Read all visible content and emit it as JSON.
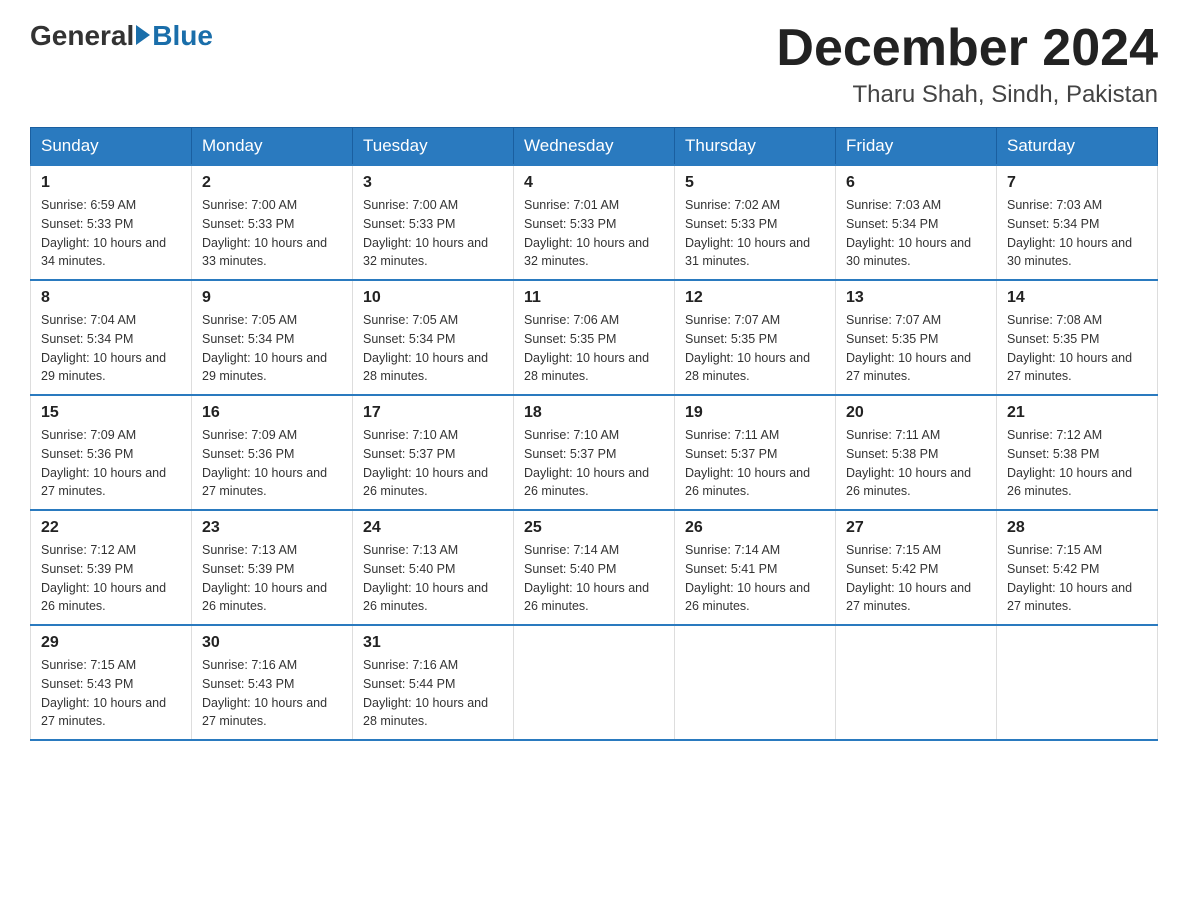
{
  "header": {
    "logo_general": "General",
    "logo_blue": "Blue",
    "month_year": "December 2024",
    "location": "Tharu Shah, Sindh, Pakistan"
  },
  "days_of_week": [
    "Sunday",
    "Monday",
    "Tuesday",
    "Wednesday",
    "Thursday",
    "Friday",
    "Saturday"
  ],
  "weeks": [
    [
      {
        "day": "1",
        "sunrise": "6:59 AM",
        "sunset": "5:33 PM",
        "daylight": "10 hours and 34 minutes."
      },
      {
        "day": "2",
        "sunrise": "7:00 AM",
        "sunset": "5:33 PM",
        "daylight": "10 hours and 33 minutes."
      },
      {
        "day": "3",
        "sunrise": "7:00 AM",
        "sunset": "5:33 PM",
        "daylight": "10 hours and 32 minutes."
      },
      {
        "day": "4",
        "sunrise": "7:01 AM",
        "sunset": "5:33 PM",
        "daylight": "10 hours and 32 minutes."
      },
      {
        "day": "5",
        "sunrise": "7:02 AM",
        "sunset": "5:33 PM",
        "daylight": "10 hours and 31 minutes."
      },
      {
        "day": "6",
        "sunrise": "7:03 AM",
        "sunset": "5:34 PM",
        "daylight": "10 hours and 30 minutes."
      },
      {
        "day": "7",
        "sunrise": "7:03 AM",
        "sunset": "5:34 PM",
        "daylight": "10 hours and 30 minutes."
      }
    ],
    [
      {
        "day": "8",
        "sunrise": "7:04 AM",
        "sunset": "5:34 PM",
        "daylight": "10 hours and 29 minutes."
      },
      {
        "day": "9",
        "sunrise": "7:05 AM",
        "sunset": "5:34 PM",
        "daylight": "10 hours and 29 minutes."
      },
      {
        "day": "10",
        "sunrise": "7:05 AM",
        "sunset": "5:34 PM",
        "daylight": "10 hours and 28 minutes."
      },
      {
        "day": "11",
        "sunrise": "7:06 AM",
        "sunset": "5:35 PM",
        "daylight": "10 hours and 28 minutes."
      },
      {
        "day": "12",
        "sunrise": "7:07 AM",
        "sunset": "5:35 PM",
        "daylight": "10 hours and 28 minutes."
      },
      {
        "day": "13",
        "sunrise": "7:07 AM",
        "sunset": "5:35 PM",
        "daylight": "10 hours and 27 minutes."
      },
      {
        "day": "14",
        "sunrise": "7:08 AM",
        "sunset": "5:35 PM",
        "daylight": "10 hours and 27 minutes."
      }
    ],
    [
      {
        "day": "15",
        "sunrise": "7:09 AM",
        "sunset": "5:36 PM",
        "daylight": "10 hours and 27 minutes."
      },
      {
        "day": "16",
        "sunrise": "7:09 AM",
        "sunset": "5:36 PM",
        "daylight": "10 hours and 27 minutes."
      },
      {
        "day": "17",
        "sunrise": "7:10 AM",
        "sunset": "5:37 PM",
        "daylight": "10 hours and 26 minutes."
      },
      {
        "day": "18",
        "sunrise": "7:10 AM",
        "sunset": "5:37 PM",
        "daylight": "10 hours and 26 minutes."
      },
      {
        "day": "19",
        "sunrise": "7:11 AM",
        "sunset": "5:37 PM",
        "daylight": "10 hours and 26 minutes."
      },
      {
        "day": "20",
        "sunrise": "7:11 AM",
        "sunset": "5:38 PM",
        "daylight": "10 hours and 26 minutes."
      },
      {
        "day": "21",
        "sunrise": "7:12 AM",
        "sunset": "5:38 PM",
        "daylight": "10 hours and 26 minutes."
      }
    ],
    [
      {
        "day": "22",
        "sunrise": "7:12 AM",
        "sunset": "5:39 PM",
        "daylight": "10 hours and 26 minutes."
      },
      {
        "day": "23",
        "sunrise": "7:13 AM",
        "sunset": "5:39 PM",
        "daylight": "10 hours and 26 minutes."
      },
      {
        "day": "24",
        "sunrise": "7:13 AM",
        "sunset": "5:40 PM",
        "daylight": "10 hours and 26 minutes."
      },
      {
        "day": "25",
        "sunrise": "7:14 AM",
        "sunset": "5:40 PM",
        "daylight": "10 hours and 26 minutes."
      },
      {
        "day": "26",
        "sunrise": "7:14 AM",
        "sunset": "5:41 PM",
        "daylight": "10 hours and 26 minutes."
      },
      {
        "day": "27",
        "sunrise": "7:15 AM",
        "sunset": "5:42 PM",
        "daylight": "10 hours and 27 minutes."
      },
      {
        "day": "28",
        "sunrise": "7:15 AM",
        "sunset": "5:42 PM",
        "daylight": "10 hours and 27 minutes."
      }
    ],
    [
      {
        "day": "29",
        "sunrise": "7:15 AM",
        "sunset": "5:43 PM",
        "daylight": "10 hours and 27 minutes."
      },
      {
        "day": "30",
        "sunrise": "7:16 AM",
        "sunset": "5:43 PM",
        "daylight": "10 hours and 27 minutes."
      },
      {
        "day": "31",
        "sunrise": "7:16 AM",
        "sunset": "5:44 PM",
        "daylight": "10 hours and 28 minutes."
      },
      null,
      null,
      null,
      null
    ]
  ]
}
